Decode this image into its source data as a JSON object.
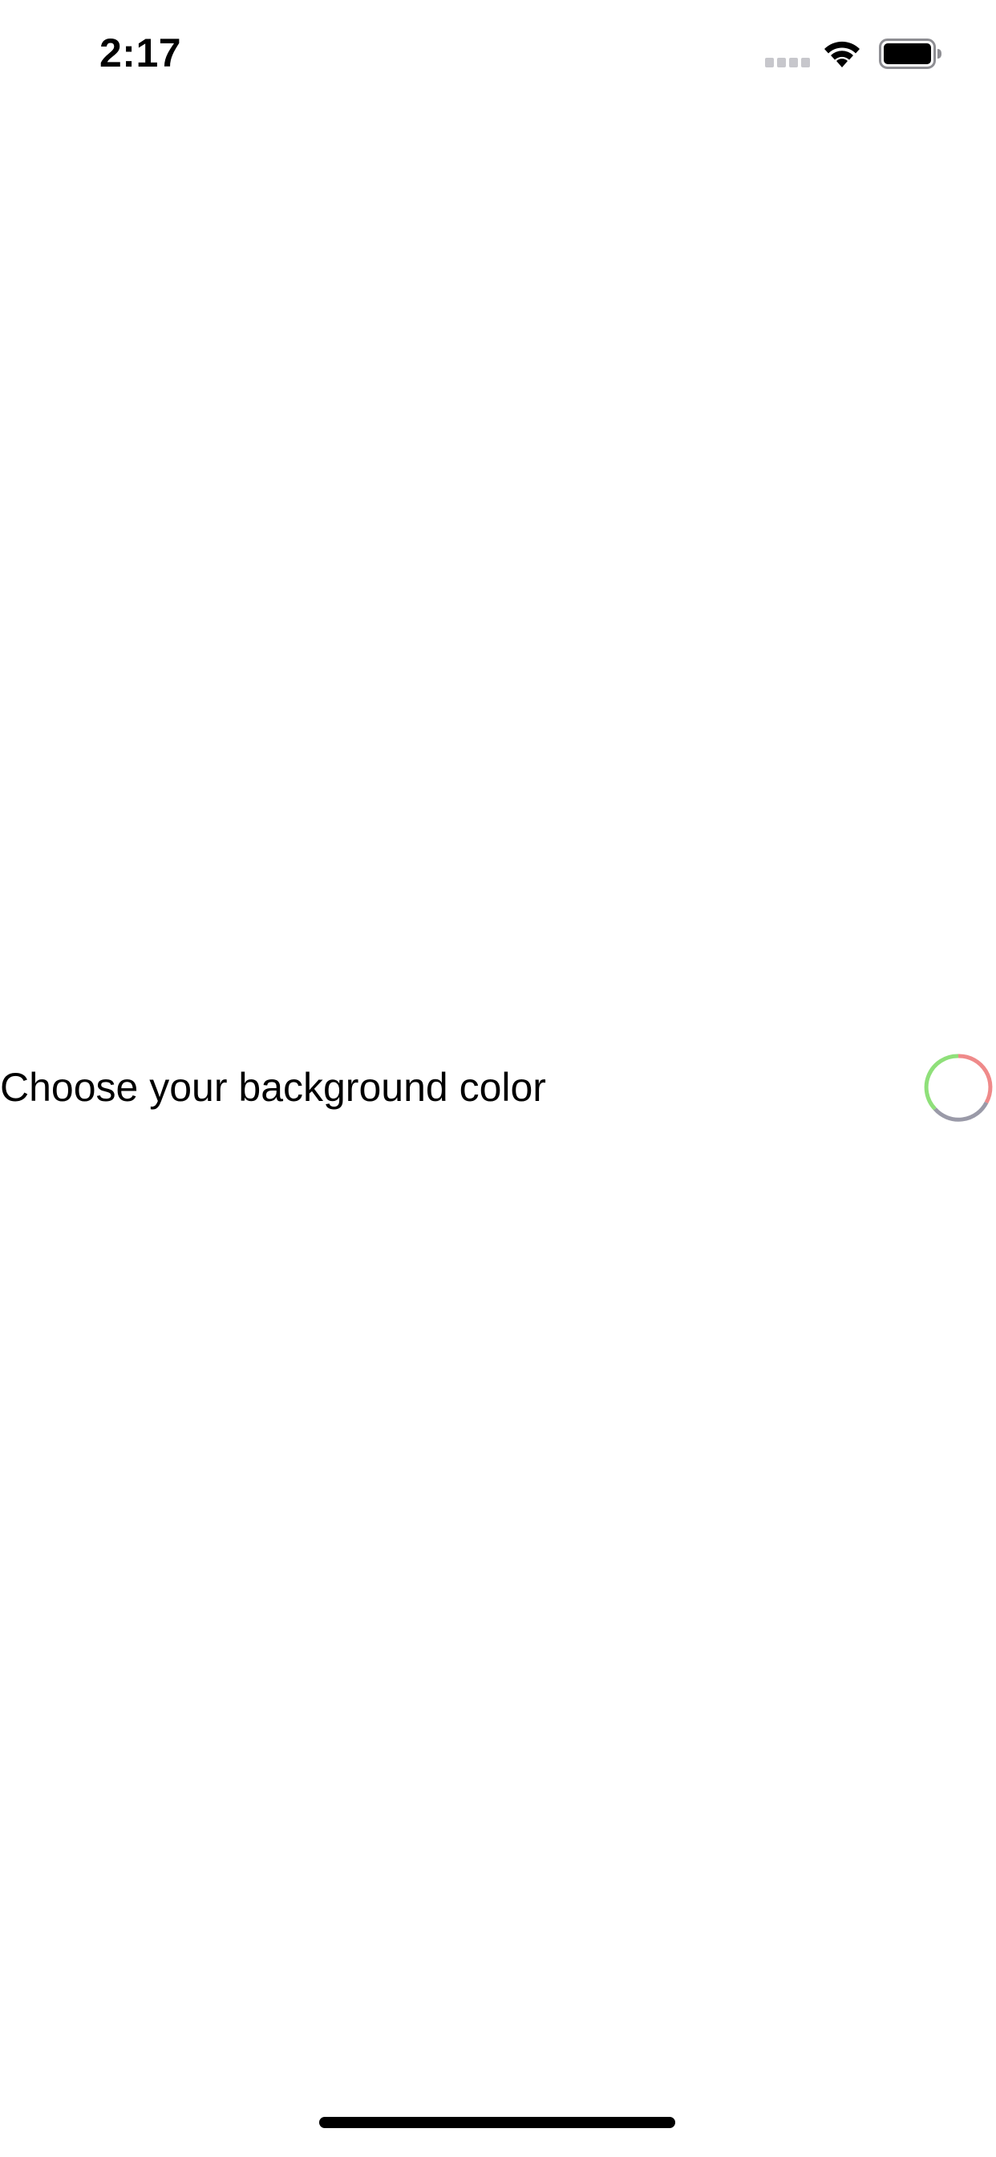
{
  "status_bar": {
    "time": "2:17",
    "icons": [
      "cellular-signal-icon",
      "wifi-icon",
      "battery-icon"
    ]
  },
  "content": {
    "color_label": "Choose your background color",
    "color_well_icon": "color-well-icon"
  },
  "colors": {
    "background": "#ffffff",
    "text": "#000000",
    "signal_inactive": "#c7c7cc",
    "well_green": "#8fe07a",
    "well_red": "#ef8a8a",
    "well_gray": "#9a9aa8"
  }
}
